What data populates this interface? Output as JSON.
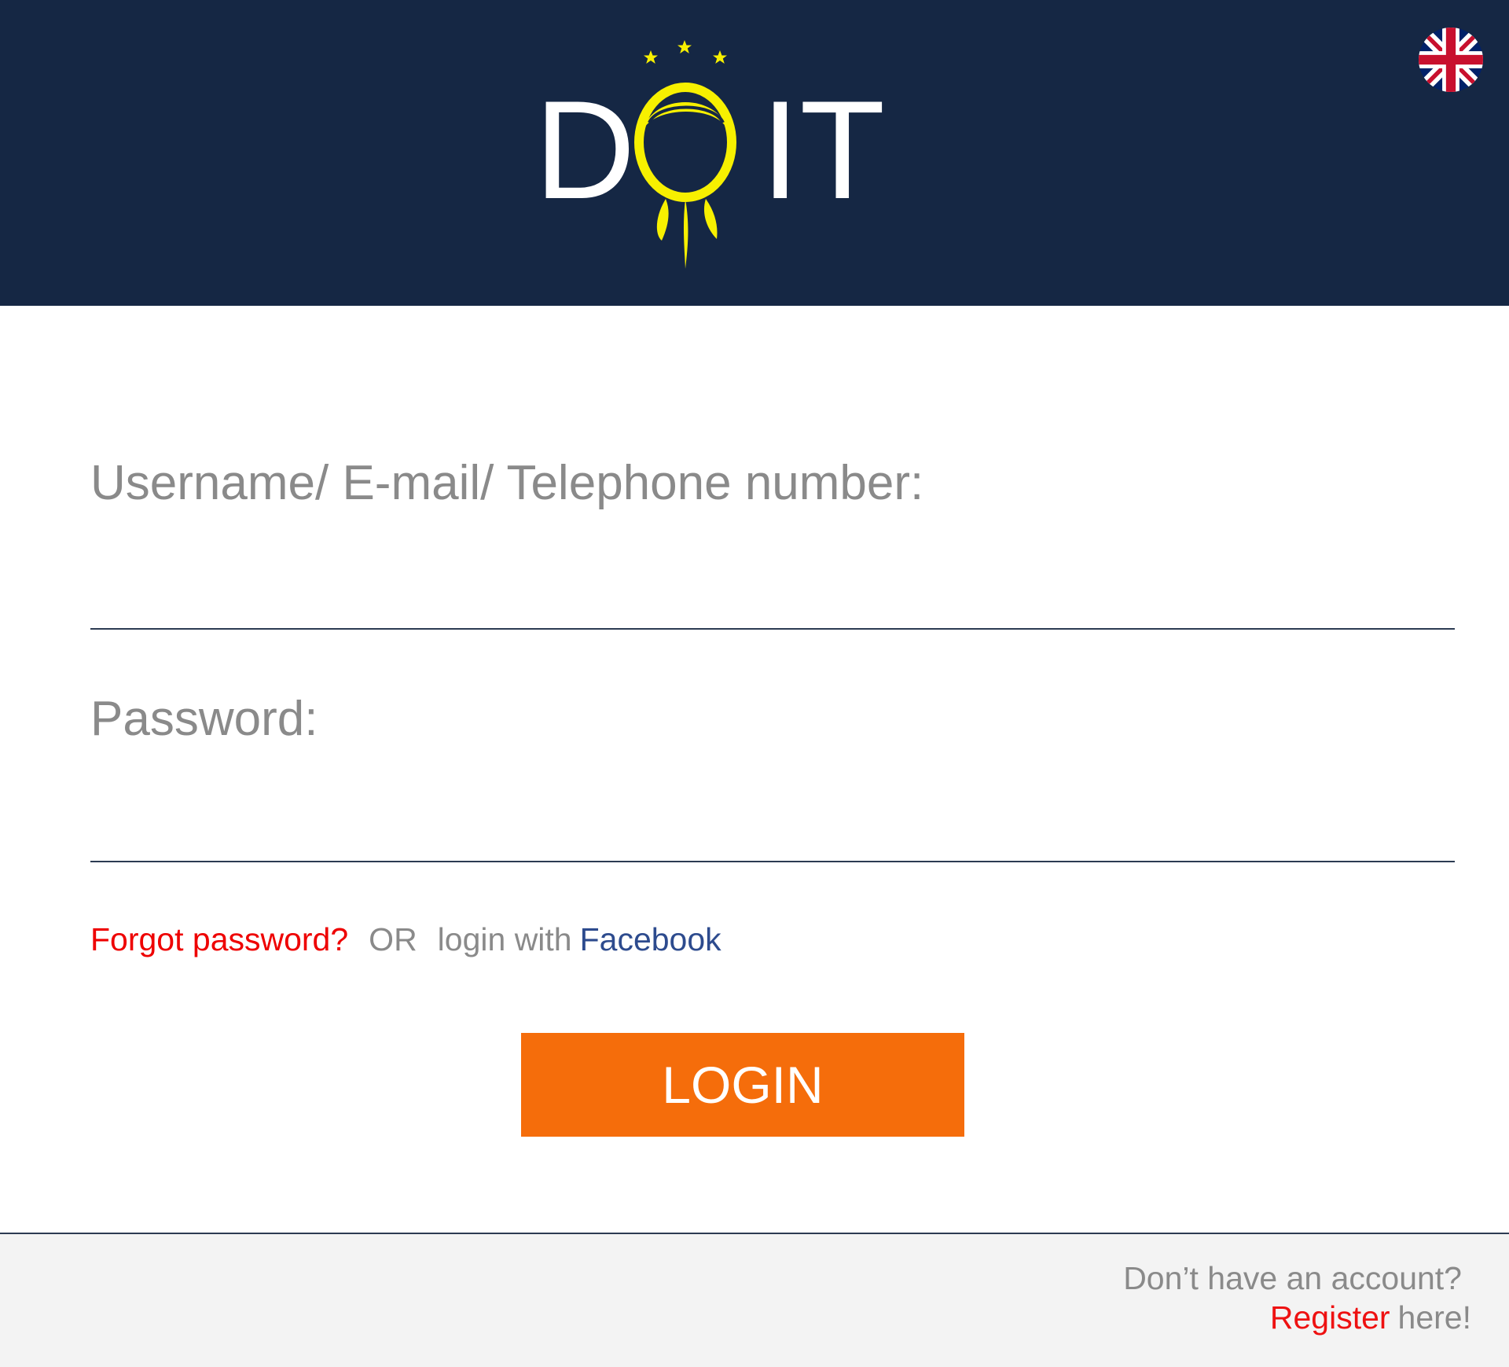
{
  "header": {
    "logo_text_left": "D",
    "logo_text_right": "IT",
    "logo_accent_color": "#f7f000",
    "background_color": "#152744",
    "language_icon": "uk-flag-icon"
  },
  "form": {
    "username_label": "Username/ E-mail/ Telephone number:",
    "username_value": "",
    "password_label": "Password:",
    "password_value": "",
    "forgot_password": "Forgot password?",
    "or_text": "OR",
    "login_with_text": "login with",
    "facebook_text": "Facebook",
    "login_button": "LOGIN",
    "button_color": "#f56d0b"
  },
  "footer": {
    "question": "Don’t have an account?",
    "register_link": "Register",
    "here_text": "here!"
  }
}
